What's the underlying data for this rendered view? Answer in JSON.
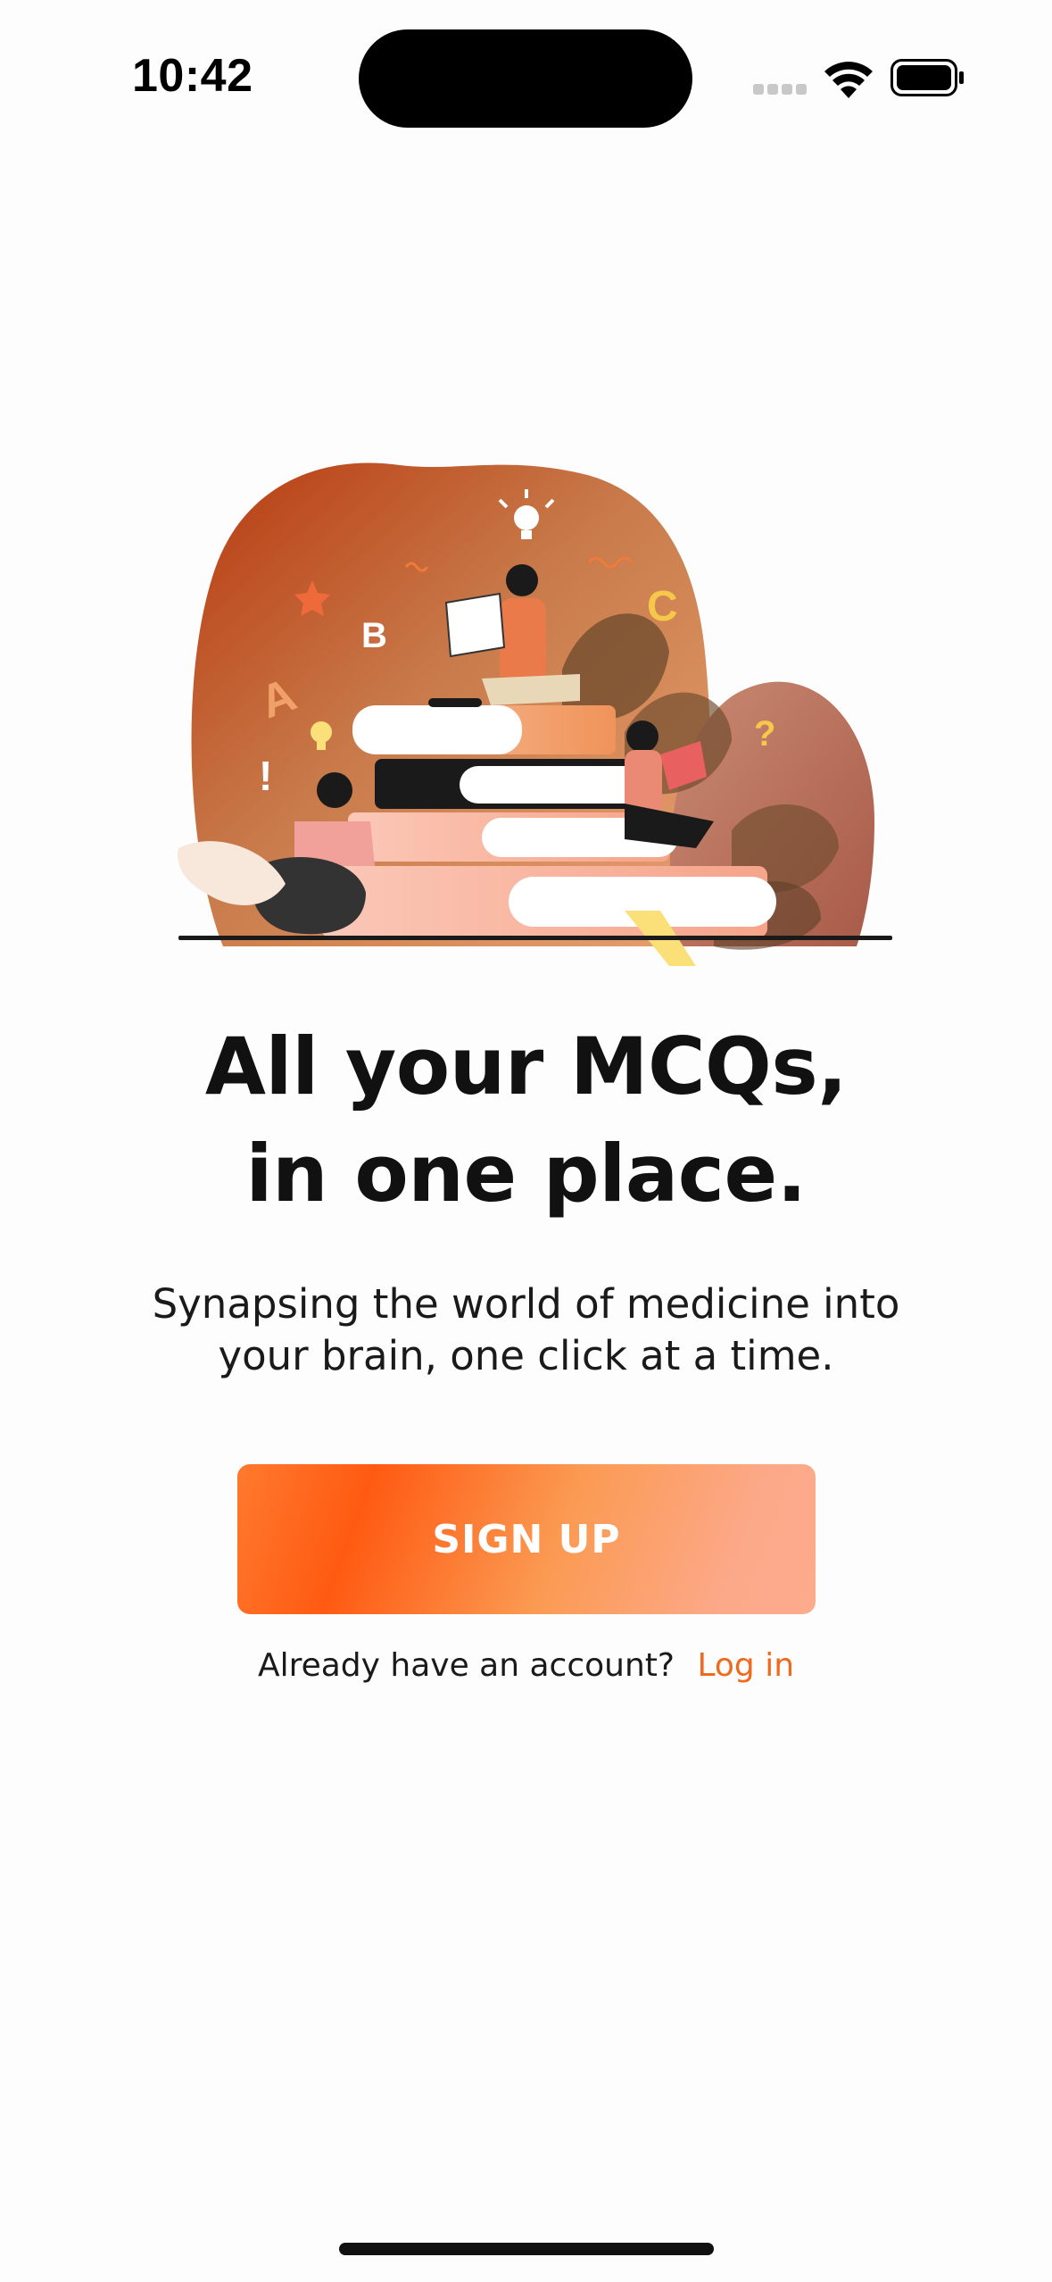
{
  "status_bar": {
    "time": "10:42"
  },
  "hero": {
    "letters": [
      "A",
      "B",
      "C",
      "?",
      "!"
    ]
  },
  "headline": {
    "line1": "All your MCQs,",
    "line2": "in one place."
  },
  "subtitle": {
    "line1": "Synapsing the world of medicine into",
    "line2": "your brain, one click at a time."
  },
  "signup": {
    "label": "SIGN UP"
  },
  "login": {
    "prompt": "Already have an account?",
    "link_label": "Log in"
  },
  "colors": {
    "accent": "#f06a1e",
    "button_start": "#ff5a12",
    "button_end": "#fcab8c",
    "background": "#fdfdfd"
  },
  "icons": [
    "signal-icon",
    "wifi-icon",
    "battery-icon"
  ]
}
